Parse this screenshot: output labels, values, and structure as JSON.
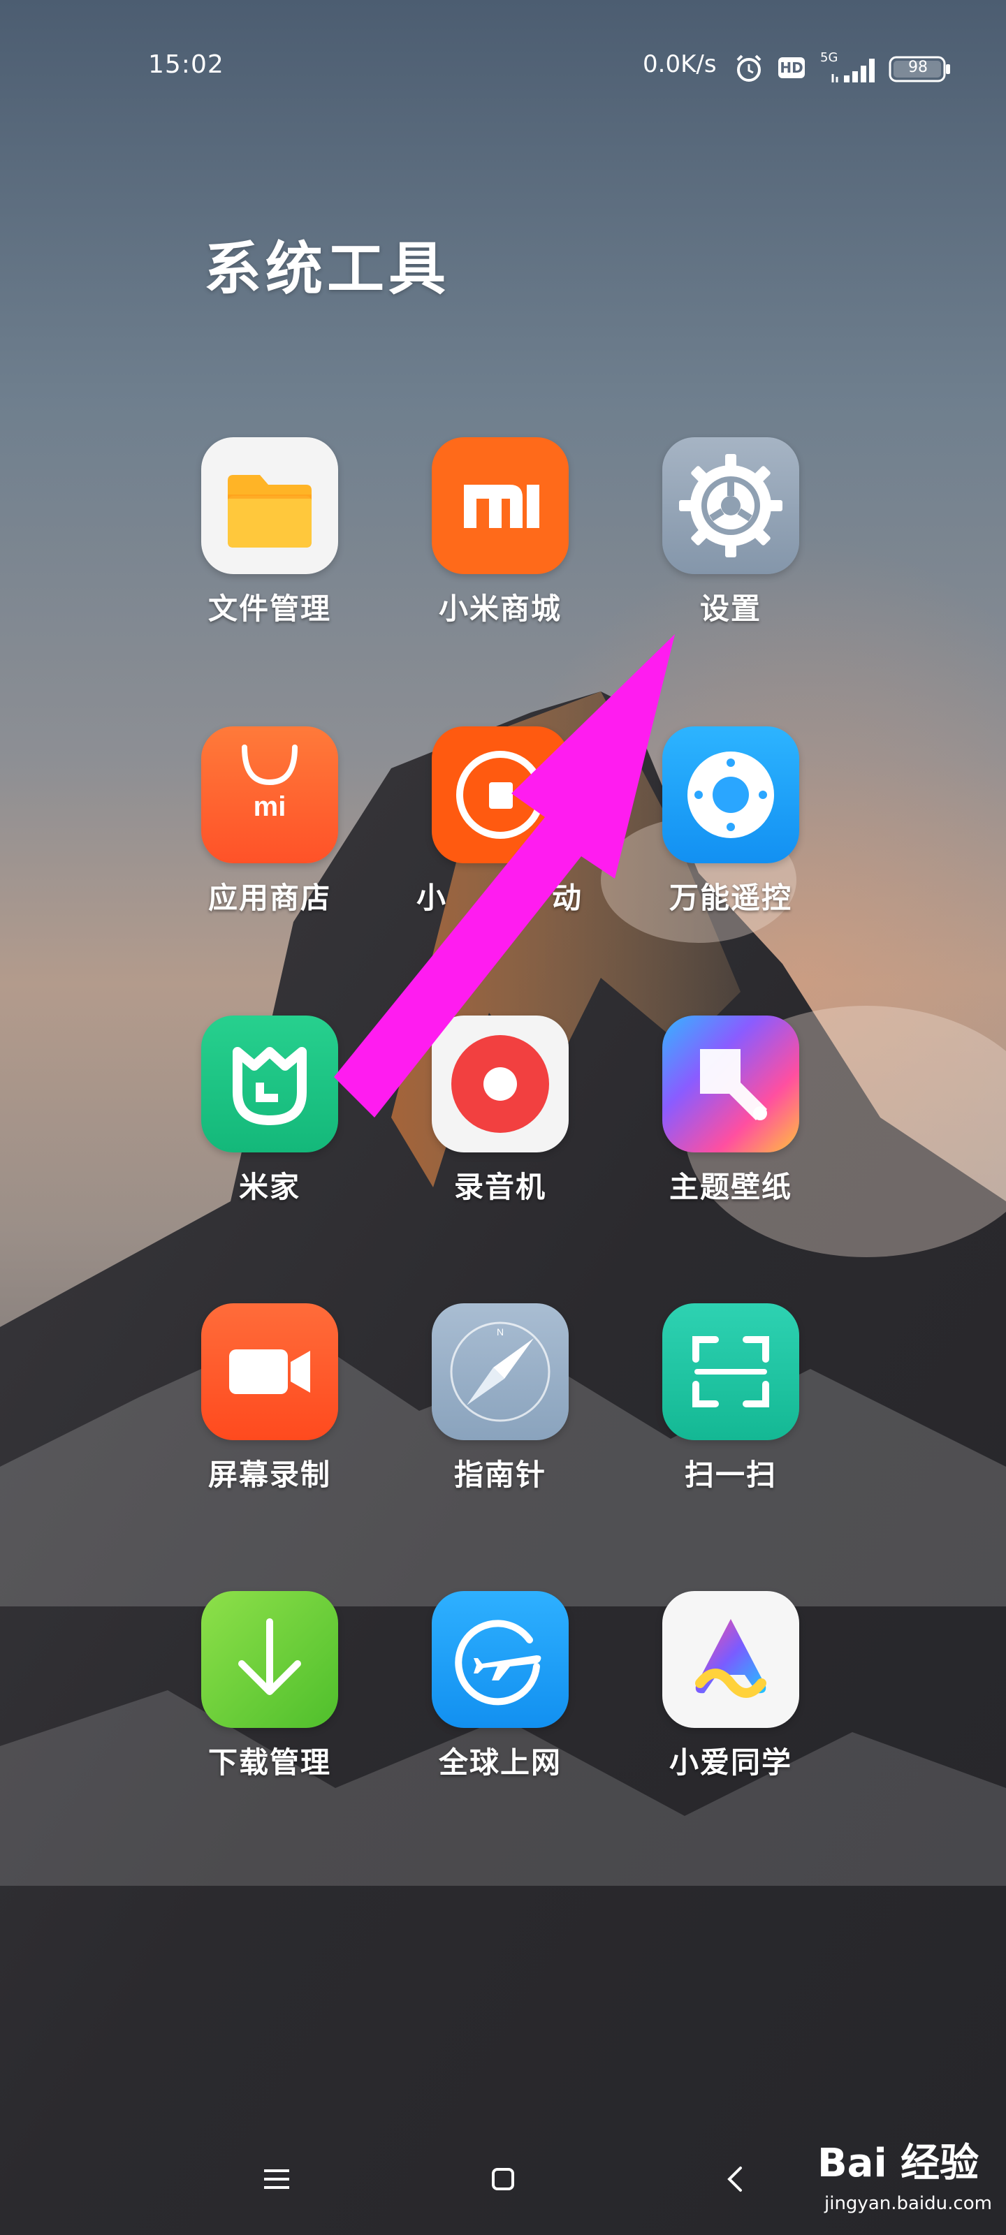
{
  "status_bar": {
    "time": "15:02",
    "net_speed": "0.0K/s",
    "hd_label": "HD",
    "network": "5G",
    "battery": "98"
  },
  "folder_title": "系统工具",
  "apps": [
    {
      "label": "文件管理",
      "icon": "folder-icon",
      "color": "#ffb426"
    },
    {
      "label": "小米商城",
      "icon": "mi-logo-icon",
      "color": "#ff6a1a"
    },
    {
      "label": "设置",
      "icon": "gear-icon",
      "color": "#8fa0b2"
    },
    {
      "label": "应用商店",
      "icon": "shopping-bag-icon",
      "color": "#ff6230"
    },
    {
      "label": "小",
      "label_right": "动",
      "icon": "mi-sport-icon",
      "color": "#ff5a10"
    },
    {
      "label": "万能遥控",
      "icon": "remote-icon",
      "color": "#1ea7ff"
    },
    {
      "label": "米家",
      "icon": "mijia-icon",
      "color": "#1fc886"
    },
    {
      "label": "录音机",
      "icon": "recorder-icon",
      "color": "#f24040"
    },
    {
      "label": "主题壁纸",
      "icon": "paint-brush-icon",
      "color": "#ff5aa0"
    },
    {
      "label": "屏幕录制",
      "icon": "video-camera-icon",
      "color": "#ff5a2a"
    },
    {
      "label": "指南针",
      "icon": "compass-icon",
      "color": "#9bb2cc"
    },
    {
      "label": "扫一扫",
      "icon": "scan-icon",
      "color": "#20c8a8"
    },
    {
      "label": "下载管理",
      "icon": "download-icon",
      "color": "#6ccf3a"
    },
    {
      "label": "全球上网",
      "icon": "airplane-globe-icon",
      "color": "#1aa2ff"
    },
    {
      "label": "小爱同学",
      "icon": "xiaoai-icon",
      "color": "#ffffff"
    }
  ],
  "annotation": {
    "color": "#ff1cf0"
  },
  "nav_bar": {
    "menu": "menu-icon",
    "home": "home-icon",
    "back": "back-icon"
  },
  "watermark": {
    "logo": "Bai 经验",
    "url": "jingyan.baidu.com"
  }
}
